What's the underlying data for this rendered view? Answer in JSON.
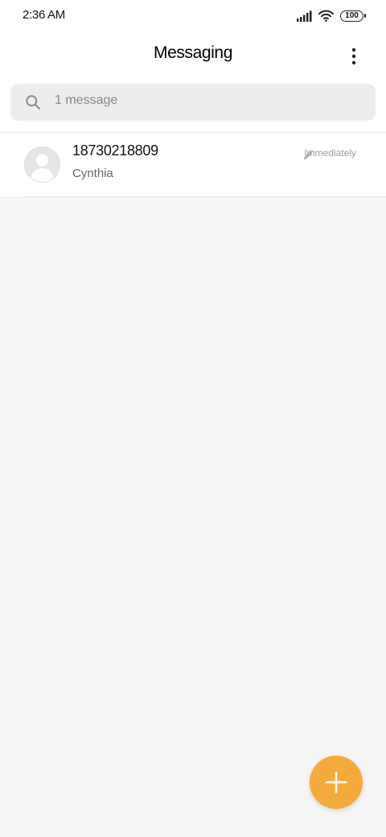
{
  "status_bar": {
    "time": "2:36 AM",
    "battery": "100",
    "signal_icon": "signal-bars-icon",
    "wifi_icon": "wifi-icon"
  },
  "header": {
    "title": "Messaging",
    "more_icon": "more-vertical-icon"
  },
  "search": {
    "placeholder": "1 message",
    "icon": "search-icon"
  },
  "conversations": [
    {
      "number": "18730218809",
      "name": "Cynthia",
      "time": "Immediately",
      "draft_icon": "pencil-icon",
      "avatar_icon": "default-avatar-icon"
    }
  ],
  "fab": {
    "icon": "plus-icon"
  },
  "colors": {
    "accent": "#f4ab3c",
    "background": "#f5f5f5",
    "surface": "#ffffff",
    "search_bg": "#ededed"
  }
}
